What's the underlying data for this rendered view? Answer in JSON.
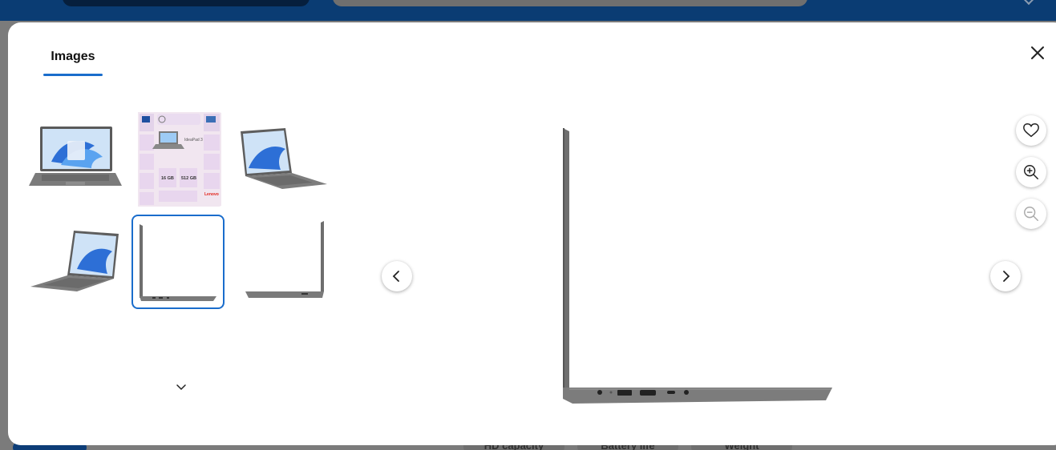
{
  "background": {
    "spec_chips": [
      "HD capacity",
      "Battery life",
      "Weight"
    ]
  },
  "modal": {
    "tabs": [
      {
        "label": "Images"
      }
    ],
    "thumbnails": [
      {
        "name": "laptop-front-view",
        "selected": false
      },
      {
        "name": "laptop-feature-infographic",
        "selected": false
      },
      {
        "name": "laptop-angle-right-view",
        "selected": false
      },
      {
        "name": "laptop-angle-left-view",
        "selected": false
      },
      {
        "name": "laptop-left-side-view",
        "selected": true
      },
      {
        "name": "laptop-right-side-view",
        "selected": false
      }
    ],
    "infographic_texts": [
      "16 GB",
      "512 GB",
      "Lenovo",
      "IdeaPad 3"
    ],
    "icons": {
      "close": "close-icon",
      "favorite": "heart-icon",
      "zoom_in": "zoom-in-icon",
      "zoom_out": "zoom-out-icon",
      "previous": "chevron-left-icon",
      "next": "chevron-right-icon",
      "more_thumbnails": "chevron-down-icon"
    }
  },
  "colors": {
    "accent": "#1a6dcc",
    "header": "#0a3c73",
    "laptop_body": "#777777"
  }
}
